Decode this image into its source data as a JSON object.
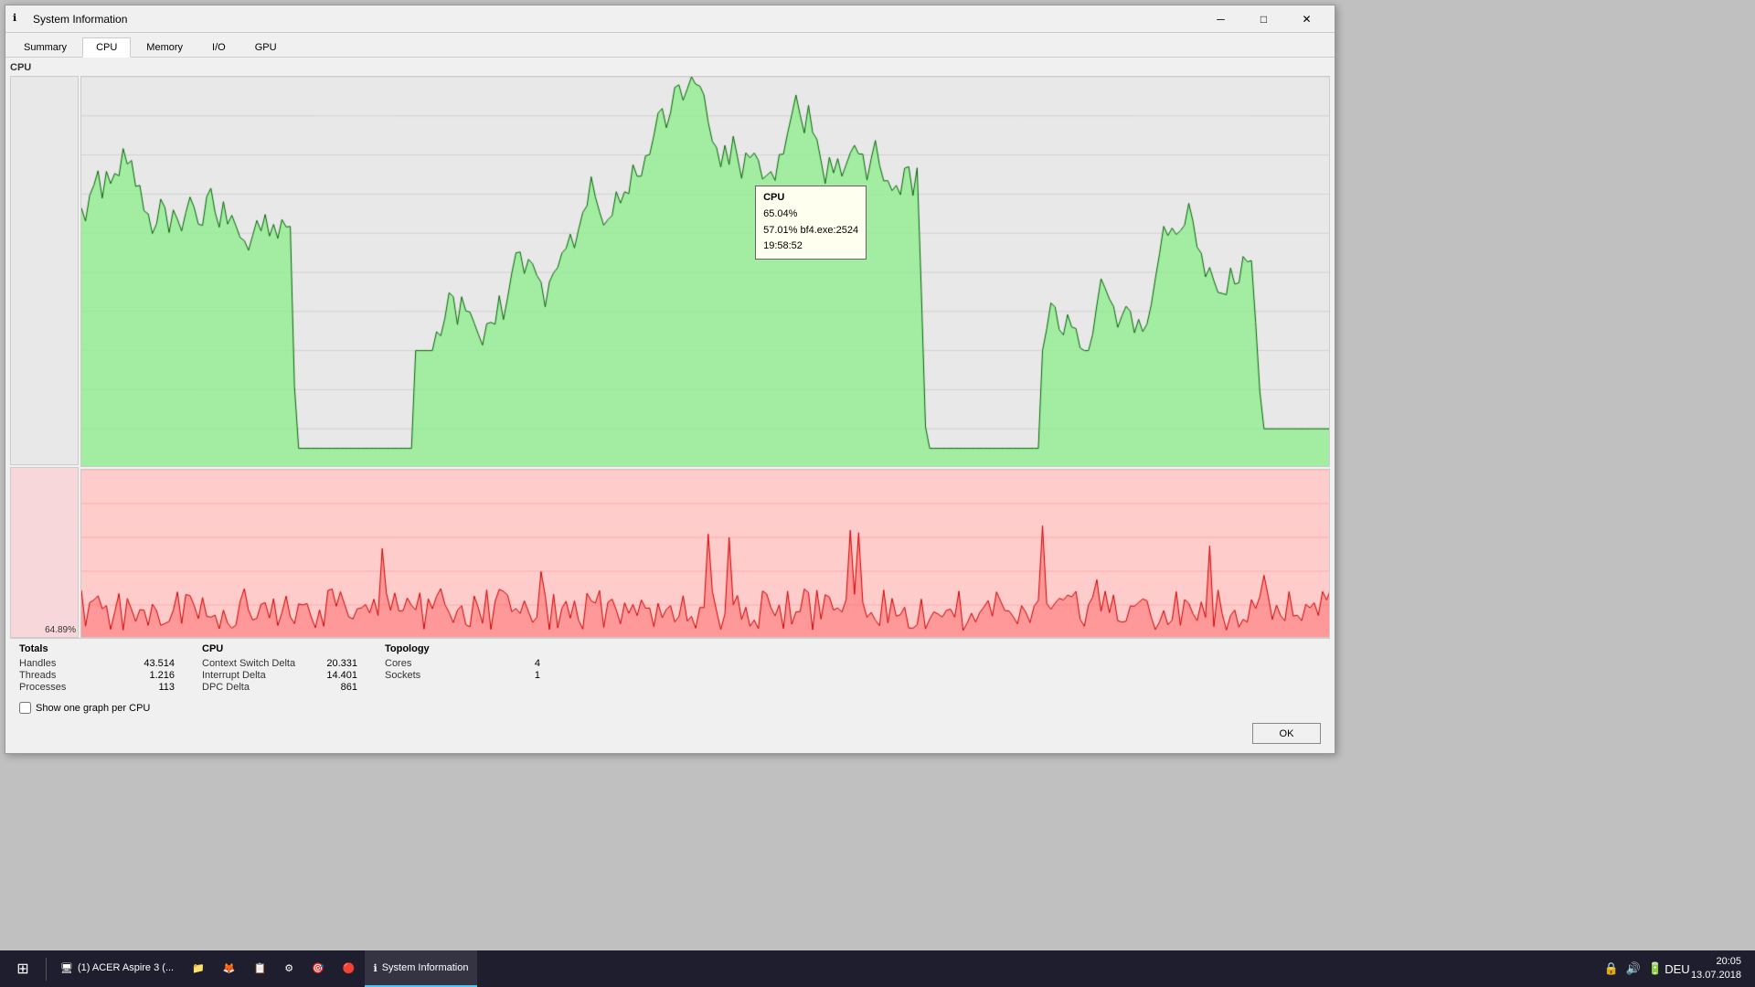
{
  "window": {
    "title": "System Information",
    "icon": "ℹ"
  },
  "tabs": [
    {
      "id": "summary",
      "label": "Summary",
      "active": false
    },
    {
      "id": "cpu",
      "label": "CPU",
      "active": true
    },
    {
      "id": "memory",
      "label": "Memory",
      "active": false
    },
    {
      "id": "io",
      "label": "I/O",
      "active": false
    },
    {
      "id": "gpu",
      "label": "GPU",
      "active": false
    }
  ],
  "cpu_section_label": "CPU",
  "tooltip": {
    "title": "CPU",
    "line1": "65.04%",
    "line2": "57.01% bf4.exe:2524",
    "line3": "19:58:52"
  },
  "percent_label": "64.89%",
  "totals": {
    "title": "Totals",
    "handles_label": "Handles",
    "handles_value": "43.514",
    "threads_label": "Threads",
    "threads_value": "1.216",
    "processes_label": "Processes",
    "processes_value": "113"
  },
  "cpu_stats": {
    "title": "CPU",
    "context_switch_label": "Context Switch Delta",
    "context_switch_value": "20.331",
    "interrupt_label": "Interrupt Delta",
    "interrupt_value": "14.401",
    "dpc_label": "DPC Delta",
    "dpc_value": "861"
  },
  "topology": {
    "title": "Topology",
    "cores_label": "Cores",
    "cores_value": "4",
    "sockets_label": "Sockets",
    "sockets_value": "1"
  },
  "checkbox_label": "Show one graph per CPU",
  "ok_label": "OK",
  "taskbar": {
    "start_icon": "⊞",
    "items": [
      {
        "label": "Windows",
        "icon": "⊞"
      },
      {
        "label": "(1) ACER Aspire 3 (...",
        "icon": "🖥",
        "active": false
      },
      {
        "label": "",
        "icon": "📁",
        "active": false
      },
      {
        "label": "",
        "icon": "🦊",
        "active": false
      },
      {
        "label": "",
        "icon": "📋",
        "active": false
      },
      {
        "label": "",
        "icon": "⚙",
        "active": false
      },
      {
        "label": "",
        "icon": "🎯",
        "active": false
      },
      {
        "label": "",
        "icon": "🔴",
        "active": false
      },
      {
        "label": "System Information",
        "icon": "ℹ",
        "active": true
      }
    ],
    "tray": {
      "lang": "DEU",
      "time": "20:05",
      "date": "13.07.2018"
    }
  }
}
